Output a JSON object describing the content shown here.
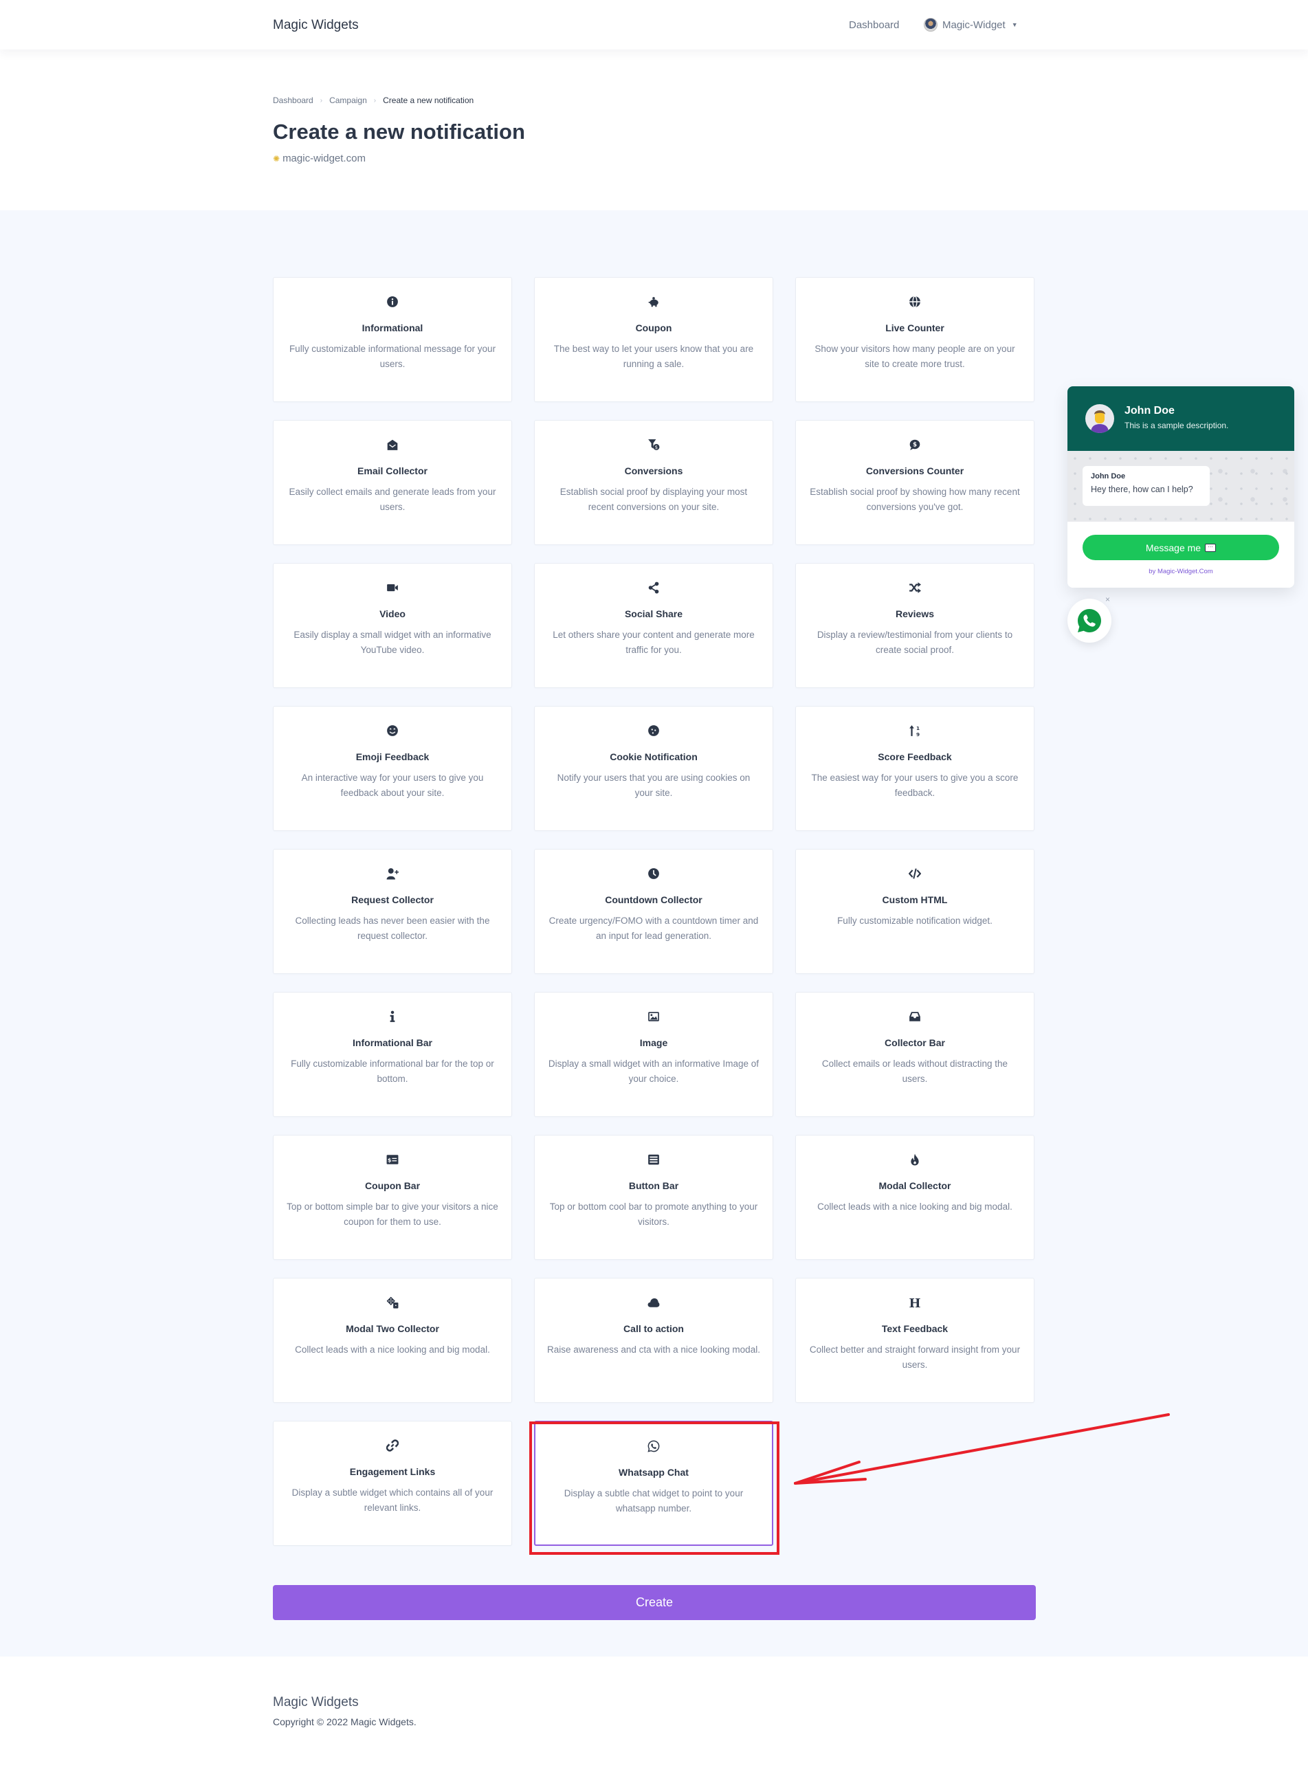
{
  "topbar": {
    "brand": "Magic Widgets",
    "nav_dashboard": "Dashboard",
    "user_name": "Magic-Widget"
  },
  "breadcrumb": {
    "items": [
      "Dashboard",
      "Campaign"
    ],
    "current": "Create a new notification"
  },
  "page": {
    "title": "Create a new notification",
    "site": "magic-widget.com"
  },
  "cards": [
    {
      "icon": "info-circle-icon",
      "title": "Informational",
      "desc": "Fully customizable informational message for your users."
    },
    {
      "icon": "piggy-bank-icon",
      "title": "Coupon",
      "desc": "The best way to let your users know that you are running a sale."
    },
    {
      "icon": "globe-icon",
      "title": "Live Counter",
      "desc": "Show your visitors how many people are on your site to create more trust."
    },
    {
      "icon": "envelope-open-icon",
      "title": "Email Collector",
      "desc": "Easily collect emails and generate leads from your users."
    },
    {
      "icon": "funnel-dollar-icon",
      "title": "Conversions",
      "desc": "Establish social proof by displaying your most recent conversions on your site."
    },
    {
      "icon": "comment-dollar-icon",
      "title": "Conversions Counter",
      "desc": "Establish social proof by showing how many recent conversions you've got."
    },
    {
      "icon": "video-icon",
      "title": "Video",
      "desc": "Easily display a small widget with an informative YouTube video."
    },
    {
      "icon": "share-icon",
      "title": "Social Share",
      "desc": "Let others share your content and generate more traffic for you."
    },
    {
      "icon": "shuffle-icon",
      "title": "Reviews",
      "desc": "Display a review/testimonial from your clients to create social proof."
    },
    {
      "icon": "smile-icon",
      "title": "Emoji Feedback",
      "desc": "An interactive way for your users to give you feedback about your site."
    },
    {
      "icon": "cookie-icon",
      "title": "Cookie Notification",
      "desc": "Notify your users that you are using cookies on your site."
    },
    {
      "icon": "sort-numeric-icon",
      "title": "Score Feedback",
      "desc": "The easiest way for your users to give you a score feedback."
    },
    {
      "icon": "user-plus-icon",
      "title": "Request Collector",
      "desc": "Collecting leads has never been easier with the request collector."
    },
    {
      "icon": "clock-icon",
      "title": "Countdown Collector",
      "desc": "Create urgency/FOMO with a countdown timer and an input for lead generation."
    },
    {
      "icon": "code-icon",
      "title": "Custom HTML",
      "desc": "Fully customizable notification widget."
    },
    {
      "icon": "info-icon",
      "title": "Informational Bar",
      "desc": "Fully customizable informational bar for the top or bottom."
    },
    {
      "icon": "image-icon",
      "title": "Image",
      "desc": "Display a small widget with an informative Image of your choice."
    },
    {
      "icon": "inbox-icon",
      "title": "Collector Bar",
      "desc": "Collect emails or leads without distracting the users."
    },
    {
      "icon": "money-check-icon",
      "title": "Coupon Bar",
      "desc": "Top or bottom simple bar to give your visitors a nice coupon for them to use."
    },
    {
      "icon": "list-alt-icon",
      "title": "Button Bar",
      "desc": "Top or bottom cool bar to promote anything to your visitors."
    },
    {
      "icon": "fire-icon",
      "title": "Modal Collector",
      "desc": "Collect leads with a nice looking and big modal."
    },
    {
      "icon": "dice-icon",
      "title": "Modal Two Collector",
      "desc": "Collect leads with a nice looking and big modal."
    },
    {
      "icon": "cloud-icon",
      "title": "Call to action",
      "desc": "Raise awareness and cta with a nice looking modal."
    },
    {
      "icon": "heading-icon",
      "title": "Text Feedback",
      "desc": "Collect better and straight forward insight from your users."
    },
    {
      "icon": "link-icon",
      "title": "Engagement Links",
      "desc": "Display a subtle widget which contains all of your relevant links."
    },
    {
      "icon": "whatsapp-icon",
      "title": "Whatsapp Chat",
      "desc": "Display a subtle chat widget to point to your whatsapp number.",
      "selected": true
    }
  ],
  "create_label": "Create",
  "footer": {
    "title": "Magic Widgets",
    "copyright": "Copyright © 2022 Magic Widgets."
  },
  "whatsapp_preview": {
    "name": "John Doe",
    "description": "This is a sample description.",
    "bubble_name": "John Doe",
    "bubble_text": "Hey there, how can I help?",
    "button_label": "Message me",
    "branding": "by Magic-Widget.Com",
    "close_symbol": "×",
    "colors": {
      "header": "#095e54",
      "button": "#1bc65a",
      "fab_icon": "#0f9b45"
    }
  },
  "colors": {
    "accent": "#925fe2",
    "annotation": "#e8202a"
  }
}
